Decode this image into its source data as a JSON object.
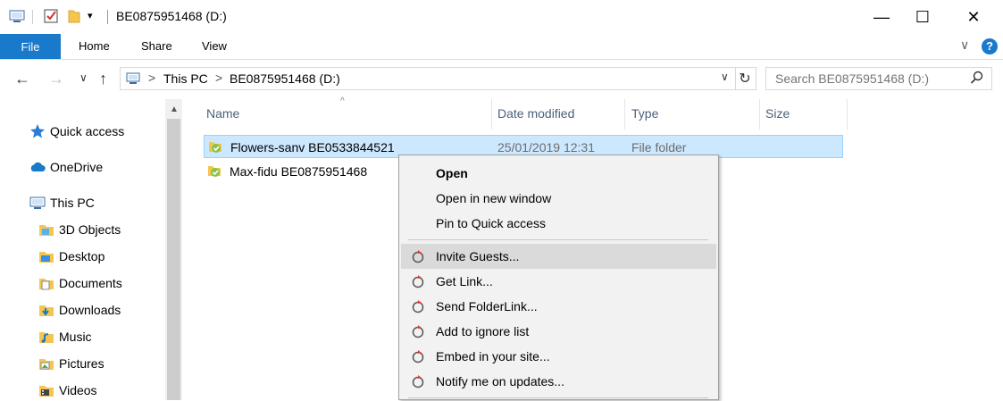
{
  "window": {
    "title": "BE0875951468 (D:)",
    "minimize_glyph": "—",
    "maximize_glyph": "☐",
    "close_glyph": "✕"
  },
  "ribbon": {
    "file_tab": "File",
    "tabs": [
      "Home",
      "Share",
      "View"
    ],
    "help_glyph": "?",
    "expand_glyph": "∨"
  },
  "address": {
    "crumbs": [
      "This PC",
      "BE0875951468 (D:)"
    ],
    "separator": ">",
    "refresh_glyph": "↻",
    "dropdown_glyph": "∨"
  },
  "search": {
    "placeholder": "Search BE0875951468 (D:)"
  },
  "navigation": {
    "back_glyph": "←",
    "forward_glyph": "→",
    "recent_glyph": "∨",
    "up_glyph": "↑"
  },
  "nav_pane": {
    "items": [
      {
        "label": "Quick access",
        "icon": "star-icon"
      },
      {
        "label": "OneDrive",
        "icon": "cloud-icon"
      },
      {
        "label": "This PC",
        "icon": "computer-icon"
      },
      {
        "label": "3D Objects",
        "icon": "folder-3d-icon"
      },
      {
        "label": "Desktop",
        "icon": "folder-desktop-icon"
      },
      {
        "label": "Documents",
        "icon": "folder-documents-icon"
      },
      {
        "label": "Downloads",
        "icon": "folder-downloads-icon"
      },
      {
        "label": "Music",
        "icon": "folder-music-icon"
      },
      {
        "label": "Pictures",
        "icon": "folder-pictures-icon"
      },
      {
        "label": "Videos",
        "icon": "folder-videos-icon"
      }
    ]
  },
  "file_list": {
    "columns": [
      "Name",
      "Date modified",
      "Type",
      "Size"
    ],
    "rows": [
      {
        "name": "Flowers-sanv BE0533844521",
        "date": "25/01/2019 12:31",
        "type": "File folder",
        "size": ""
      },
      {
        "name": "Max-fidu BE0875951468",
        "date": "",
        "type": "",
        "size": ""
      }
    ]
  },
  "context_menu": {
    "items": [
      {
        "label": "Open",
        "bold": true
      },
      {
        "label": "Open in new window"
      },
      {
        "label": "Pin to Quick access"
      },
      {
        "label": "Invite Guests..."
      },
      {
        "label": "Get Link..."
      },
      {
        "label": "Send FolderLink..."
      },
      {
        "label": "Add to ignore list"
      },
      {
        "label": "Embed in your site..."
      },
      {
        "label": "Notify me on updates..."
      }
    ]
  },
  "colors": {
    "accent": "#1979ca",
    "selection": "#cce8ff",
    "menu_highlight": "#dadada",
    "header_text": "#4c607a"
  }
}
